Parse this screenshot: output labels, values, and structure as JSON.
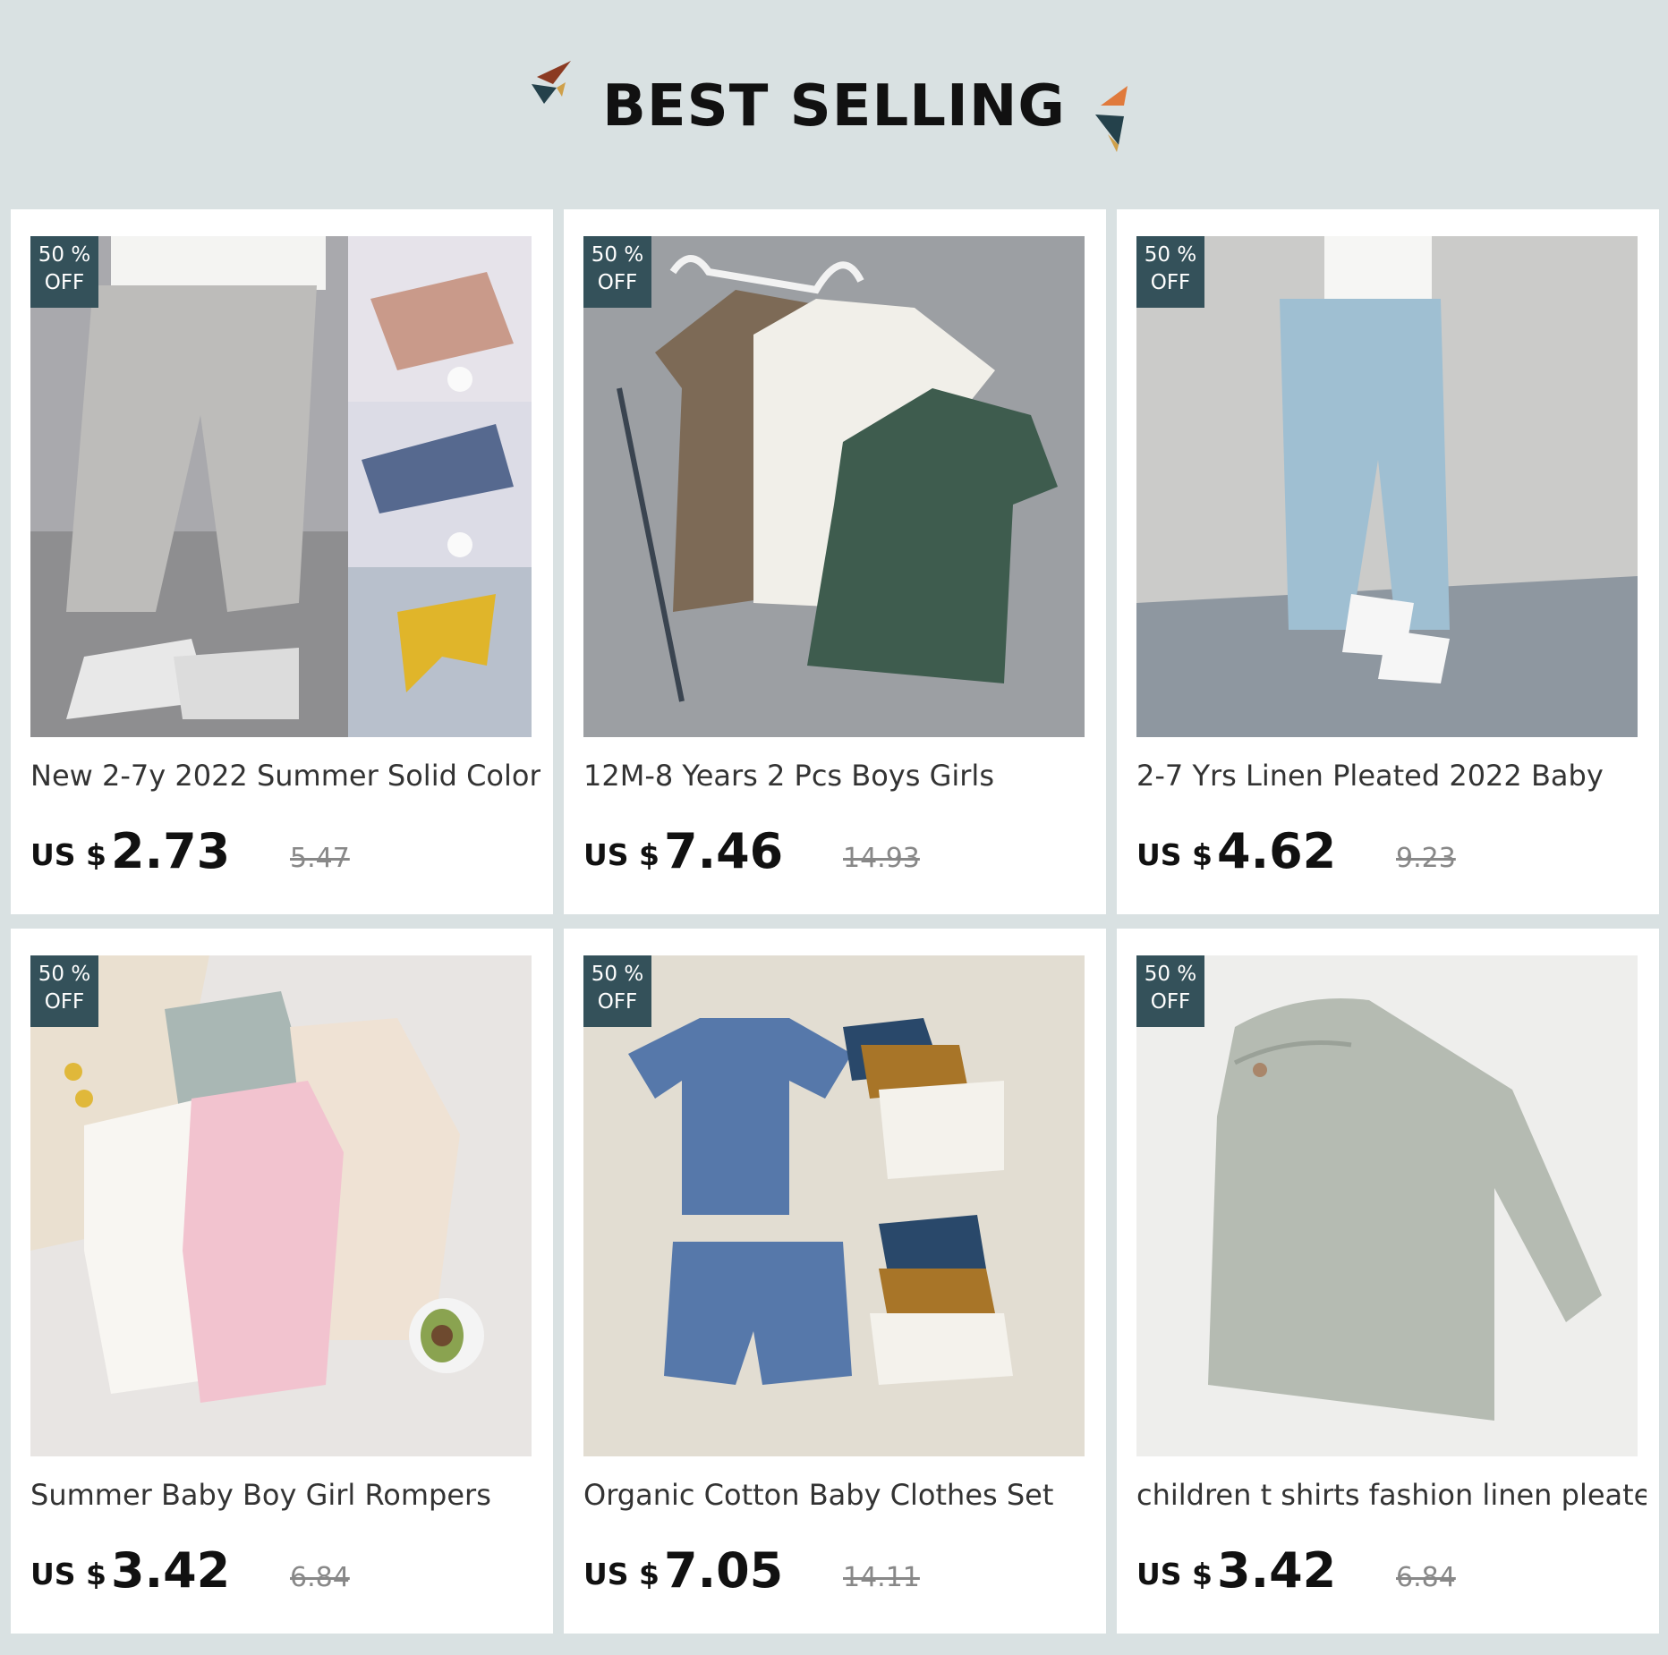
{
  "header": {
    "title": "BEST SELLING"
  },
  "products": [
    {
      "name": "New 2-7y 2022 Summer Solid Color",
      "currency": "US $",
      "price": "2.73",
      "original_price": "5.47",
      "badge_top": "50 %",
      "badge_bottom": "OFF",
      "image": "gray linen harem pants with colored swatches"
    },
    {
      "name": "12M-8 Years 2 Pcs Boys Girls",
      "currency": "US $",
      "price": "7.46",
      "original_price": "14.93",
      "badge_top": "50 %",
      "badge_bottom": "OFF",
      "image": "brown, white and green linen shirt and short sets on hangers"
    },
    {
      "name": "2-7 Yrs Linen Pleated 2022 Baby",
      "currency": "US $",
      "price": "4.62",
      "original_price": "9.23",
      "badge_top": "50 %",
      "badge_bottom": "OFF",
      "image": "light blue linen pants with white sneakers"
    },
    {
      "name": "Summer Baby Boy Girl Rompers",
      "currency": "US $",
      "price": "3.42",
      "original_price": "6.84",
      "badge_top": "50 %",
      "badge_bottom": "OFF",
      "image": "sleeveless linen rompers in pink, white, sage and cream"
    },
    {
      "name": "Organic Cotton Baby Clothes Set",
      "currency": "US $",
      "price": "7.05",
      "original_price": "14.11",
      "badge_top": "50 %",
      "badge_bottom": "OFF",
      "image": "blue tee and shorts set with folded navy, mustard and white sets"
    },
    {
      "name": "children t shirts fashion linen pleated",
      "currency": "US $",
      "price": "3.42",
      "original_price": "6.84",
      "badge_top": "50 %",
      "badge_bottom": "OFF",
      "image": "gray-green long sleeve linen shirt"
    }
  ]
}
